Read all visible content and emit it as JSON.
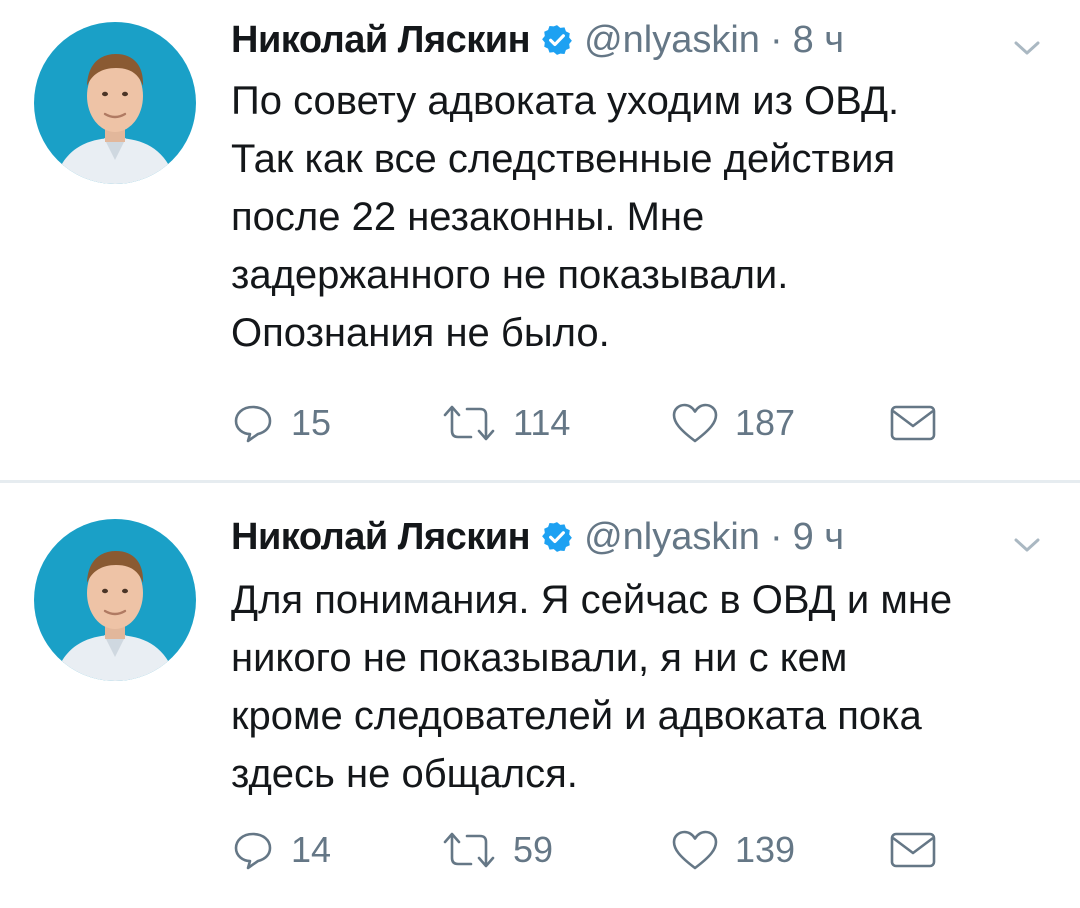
{
  "tweets": [
    {
      "author": {
        "name": "Николай Ляскин",
        "handle": "@nlyaskin",
        "verified": true
      },
      "separator": "·",
      "time": "8 ч",
      "text": "По совету адвоката уходим из ОВД. Так как все следственные действия после 22 незаконны. Мне задержанного не показывали. Опознания не было.",
      "lines": [
        "По совету адвоката уходим из ОВД.",
        "Так как все следственные действия",
        "после 22 незаконны. Мне",
        "задержанного не показывали.",
        "Опознания не было."
      ],
      "counts": {
        "replies": "15",
        "retweets": "114",
        "likes": "187"
      }
    },
    {
      "author": {
        "name": "Николай Ляскин",
        "handle": "@nlyaskin",
        "verified": true
      },
      "separator": "·",
      "time": "9 ч",
      "text": "Для понимания. Я сейчас в ОВД и мне никого не показывали, я ни с кем кроме следователей и адвоката пока здесь не общался.",
      "lines": [
        "Для понимания. Я сейчас в ОВД и мне",
        "никого не показывали, я ни с кем",
        "кроме следователей и адвоката пока",
        "здесь не общался."
      ],
      "counts": {
        "replies": "14",
        "retweets": "59",
        "likes": "139"
      }
    }
  ],
  "icons": {
    "reply": "reply-icon",
    "retweet": "retweet-icon",
    "like": "like-icon",
    "dm": "direct-message-icon",
    "verified": "verified-badge-icon",
    "caret": "chevron-down-icon",
    "avatar": "avatar-photo"
  },
  "colors": {
    "text": "#14171a",
    "secondary": "#657786",
    "verified": "#1da1f2",
    "divider": "#e6ecf0",
    "avatar_bg": "#1aa0c7"
  }
}
